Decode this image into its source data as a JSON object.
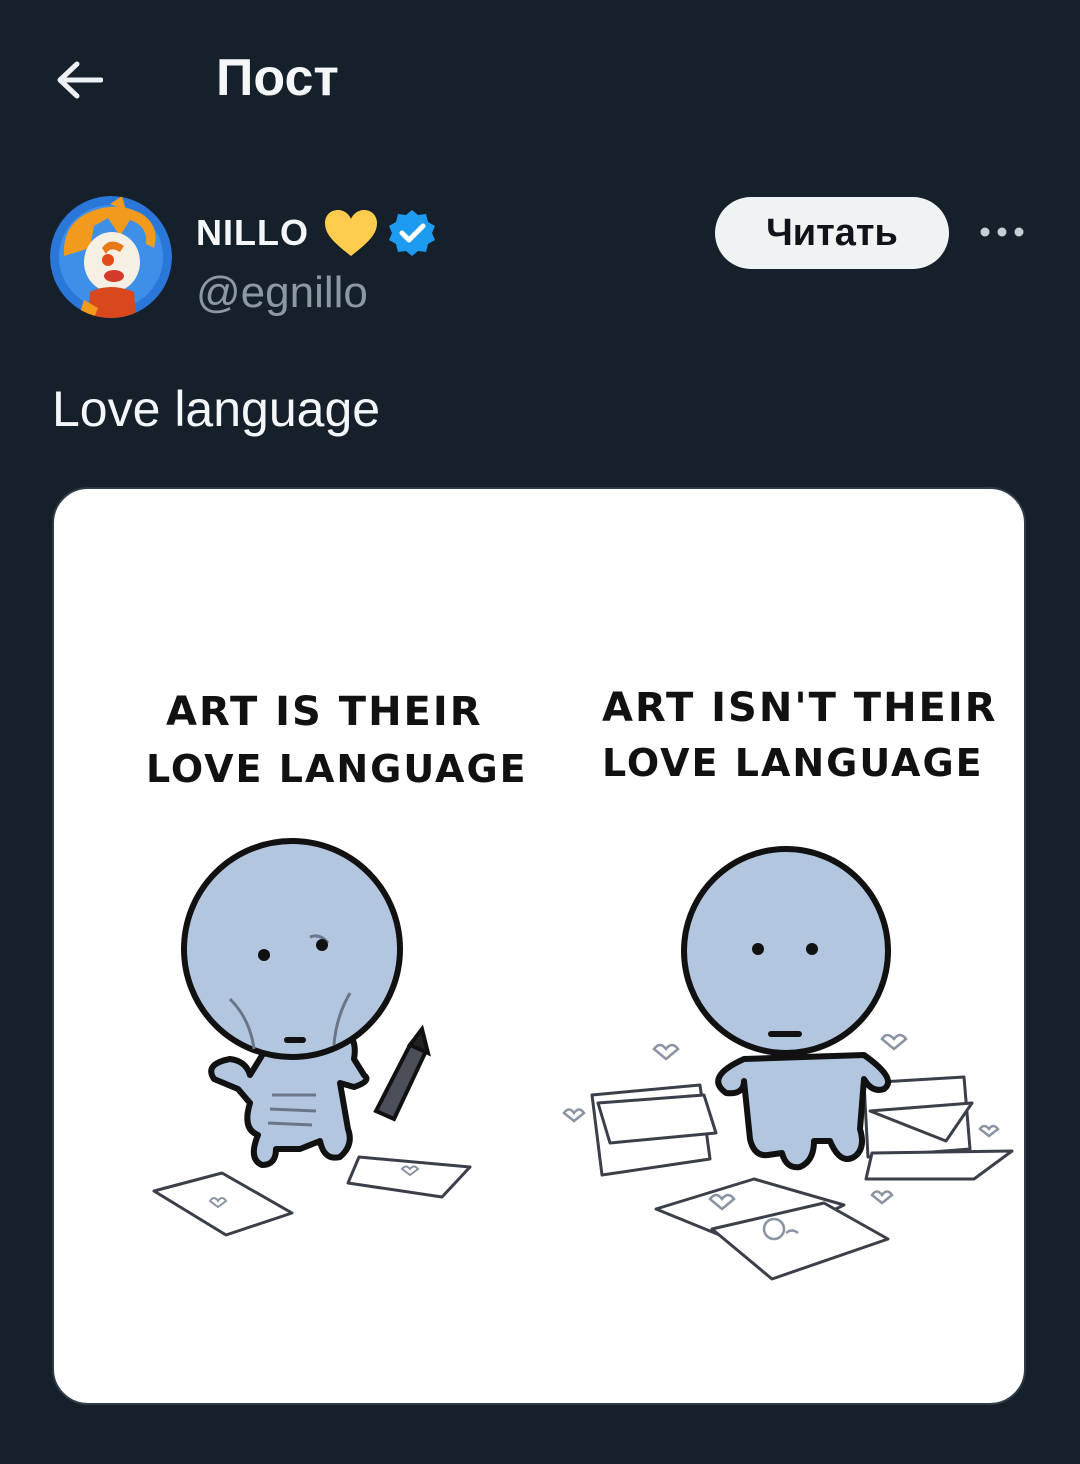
{
  "header": {
    "back_icon": "arrow-left-icon",
    "title": "Пост"
  },
  "author": {
    "display_name": "NILLO",
    "handle": "@egnillo",
    "badges": [
      "yellow-heart-icon",
      "verified-badge-icon"
    ],
    "follow_label": "Читать",
    "more_icon": "more-horizontal-icon"
  },
  "post": {
    "text": "Love language"
  },
  "media": {
    "left_caption_line1": "ART IS THEIR",
    "left_caption_line2": "LOVE LANGUAGE",
    "right_caption_line1": "ART ISN'T THEIR",
    "right_caption_line2": "LOVE LANGUAGE"
  },
  "colors": {
    "background": "#16202b",
    "follow_button": "#eff3f4",
    "verified": "#1d9bf0",
    "heart": "#ffcc4d",
    "character": "#b3c6e0"
  }
}
